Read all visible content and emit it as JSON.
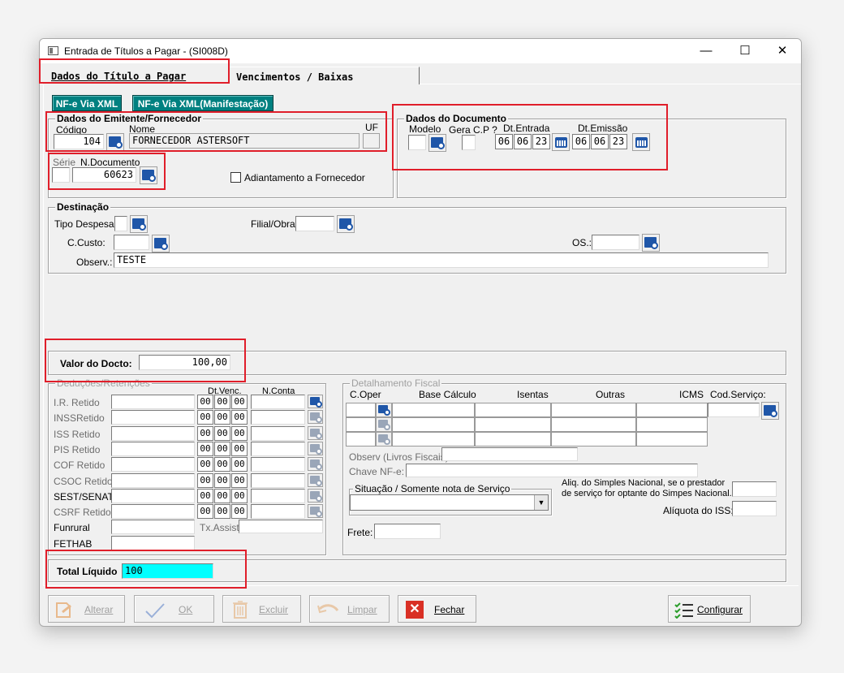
{
  "window": {
    "title": "Entrada de Títulos a Pagar - (SI008D)",
    "minimize": "—",
    "maximize": "☐",
    "close": "✕"
  },
  "tabs": [
    "Dados do Título a Pagar",
    "Vencimentos / Baixas"
  ],
  "xml_buttons": [
    "NF-e Via XML",
    "NF-e Via XML(Manifestação)"
  ],
  "emitente": {
    "group_label": "Dados do Emitente/Fornecedor",
    "codigo_label": "Código",
    "codigo_value": "104",
    "nome_label": "Nome",
    "nome_value": "FORNECEDOR ASTERSOFT",
    "uf_label": "UF",
    "uf_value": "",
    "serie_label": "Série",
    "serie_value": "",
    "ndoc_label": "N.Documento",
    "ndoc_value": "60623",
    "adiantamento_label": "Adiantamento a Fornecedor"
  },
  "documento": {
    "group_label": "Dados do Documento",
    "modelo_label": "Modelo",
    "modelo_value": "",
    "gera_label": "Gera C.P ?",
    "gera_value": "",
    "dt_entrada_label": "Dt.Entrada",
    "dt_entrada": [
      "06",
      "06",
      "23"
    ],
    "dt_emissao_label": "Dt.Emissão",
    "dt_emissao": [
      "06",
      "06",
      "23"
    ]
  },
  "destinacao": {
    "group_label": "Destinação",
    "tipo_despesa_label": "Tipo Despesa:",
    "tipo_despesa_value": "",
    "filial_label": "Filial/Obra:",
    "filial_value": "",
    "ccusto_label": "C.Custo:",
    "ccusto_value": "",
    "os_label": "OS.:",
    "os_value": "",
    "observ_label": "Observ.:",
    "observ_value": "TESTE"
  },
  "valor": {
    "label": "Valor do Docto:",
    "value": "100,00"
  },
  "deducoes": {
    "group_label": "Deduções/Retenções",
    "dtvenc_header": "Dt.Venc.",
    "nconta_header": "N.Conta",
    "rows": [
      "I.R. Retido",
      "INSSRetido",
      "ISS Retido",
      "PIS Retido",
      "COF Retido",
      "CSOC Retido",
      "SEST/SENAT",
      "CSRF Retido",
      "Funrural",
      "FETHAB"
    ],
    "date_seg": "00",
    "tx_assist_label": "Tx.Assist"
  },
  "fiscal": {
    "group_label": "Detalhamento Fiscal",
    "headers": [
      "C.Oper",
      "Base Cálculo",
      "Isentas",
      "Outras",
      "ICMS",
      "Cod.Serviço:"
    ],
    "observ_label": "Observ (Livros Fiscais):",
    "chave_label": "Chave NF-e:",
    "situacao_label": "Situação / Somente nota de Serviço",
    "aliq_simples_label_1": "Aliq. do Simples Nacional, se o prestador",
    "aliq_simples_label_2": "de serviço for optante do Simpes Nacional.",
    "aliq_iss_label": "Alíquota do ISS:",
    "frete_label": "Frete:"
  },
  "total": {
    "label": "Total Líquido",
    "value": "100"
  },
  "footer": {
    "alterar": "Alterar",
    "ok": "OK",
    "excluir": "Excluir",
    "limpar": "Limpar",
    "fechar": "Fechar",
    "configurar": "Configurar"
  },
  "colors": {
    "teal": "#008080",
    "highlight_red": "#e01e2a",
    "total_cyan": "#00ffff",
    "icon_blue": "#1f56a8"
  }
}
